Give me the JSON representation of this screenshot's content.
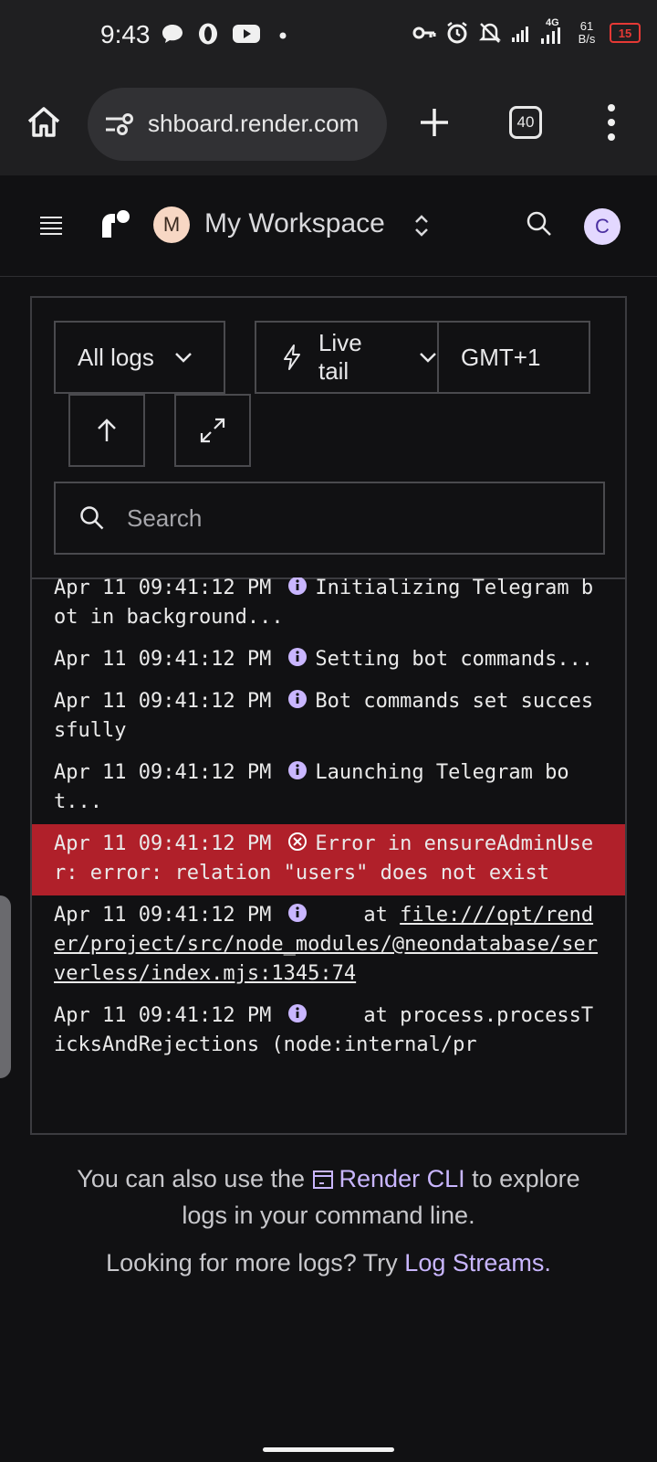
{
  "status_bar": {
    "time": "9:43",
    "network": "4G",
    "speed_value": "61",
    "speed_unit": "B/s",
    "battery": "15",
    "icons": [
      "chat-bubble-icon",
      "opera-icon",
      "youtube-icon",
      "dot-icon",
      "key-icon",
      "alarm-icon",
      "bell-off-icon",
      "signal-icon",
      "signal-4g-icon"
    ]
  },
  "browser": {
    "url": "shboard.render.com",
    "tab_count": "40",
    "icons": [
      "home-icon",
      "site-settings-icon",
      "plus-icon",
      "tabs-icon",
      "more-vert-icon"
    ]
  },
  "app_header": {
    "workspace_initial": "M",
    "workspace_name": "My Workspace",
    "user_initial": "C"
  },
  "controls": {
    "log_filter": "All logs",
    "live_tail": "Live tail",
    "timezone": "GMT+1",
    "search_placeholder": "Search"
  },
  "logs": [
    {
      "timestamp": "Apr 11 09:41:12 PM",
      "level": "info",
      "message": "Initializing Telegram bot in background..."
    },
    {
      "timestamp": "Apr 11 09:41:12 PM",
      "level": "info",
      "message": "Setting bot commands..."
    },
    {
      "timestamp": "Apr 11 09:41:12 PM",
      "level": "info",
      "message": "Bot commands set successfully"
    },
    {
      "timestamp": "Apr 11 09:41:12 PM",
      "level": "info",
      "message": "Launching Telegram bot..."
    },
    {
      "timestamp": "Apr 11 09:41:12 PM",
      "level": "error",
      "message": "Error in ensureAdminUser: error: relation \"users\" does not exist"
    },
    {
      "timestamp": "Apr 11 09:41:12 PM",
      "level": "info",
      "message": "    at ",
      "link": "file:///opt/render/project/src/node_modules/@neondatabase/serverless/index.mjs:1345:74"
    },
    {
      "timestamp": "Apr 11 09:41:12 PM",
      "level": "info",
      "message": "    at process.processTicksAndRejections (node:internal/pr"
    }
  ],
  "footer": {
    "cli_prefix": "You can also use the",
    "cli_link": "Render CLI",
    "cli_suffix": "to explore",
    "cli_line2": "logs in your command line.",
    "streams_prefix": "Looking for more logs? Try",
    "streams_link": "Log Streams."
  },
  "colors": {
    "background": "#111113",
    "error_row": "#b0202a",
    "accent_purple": "#c9b6ff",
    "battery_red": "#e53935"
  }
}
